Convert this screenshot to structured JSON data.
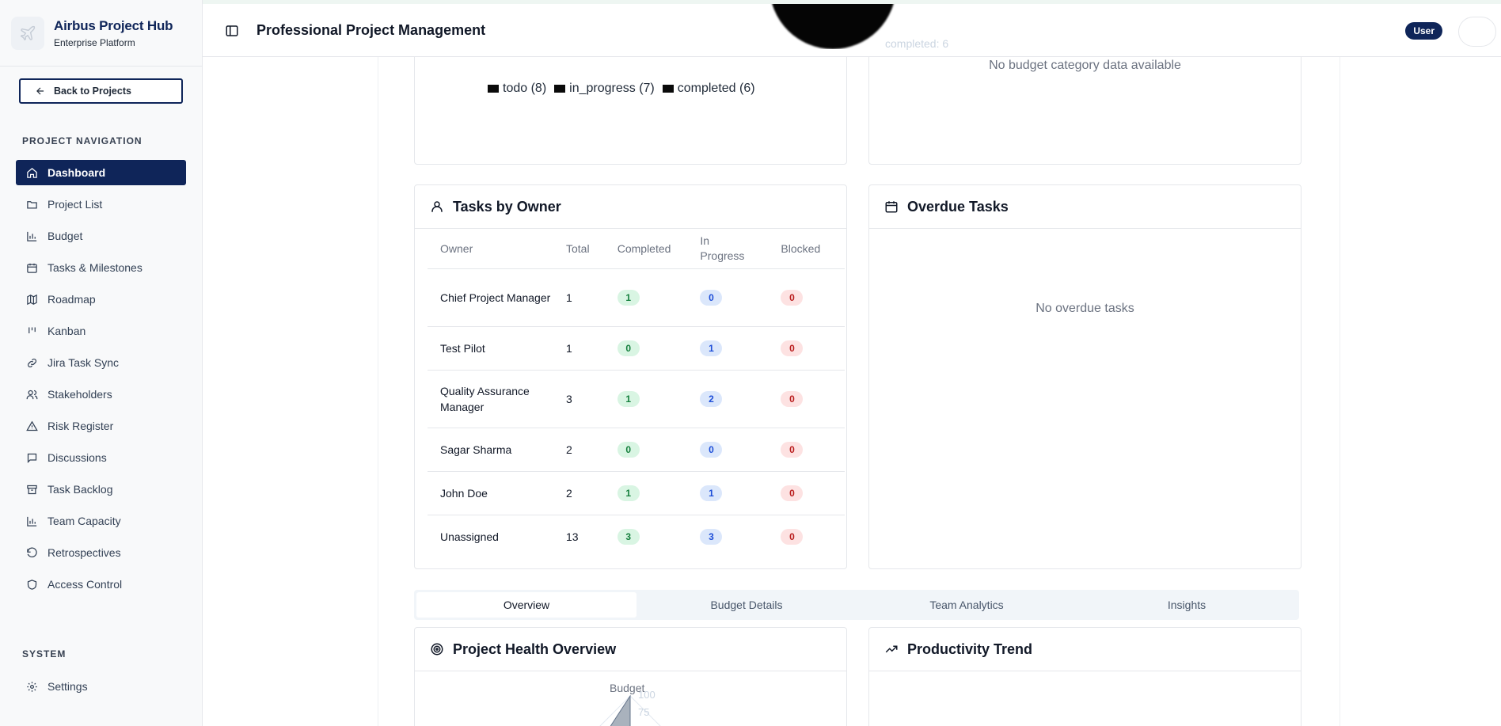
{
  "brand": {
    "title": "Airbus Project Hub",
    "subtitle": "Enterprise Platform"
  },
  "sidebar": {
    "back_label": "Back to Projects",
    "section_project": "PROJECT NAVIGATION",
    "items": [
      {
        "label": "Dashboard",
        "icon": "home-icon",
        "active": true
      },
      {
        "label": "Project List",
        "icon": "folder-icon"
      },
      {
        "label": "Budget",
        "icon": "bar-chart-icon"
      },
      {
        "label": "Tasks & Milestones",
        "icon": "calendar-icon"
      },
      {
        "label": "Roadmap",
        "icon": "map-icon"
      },
      {
        "label": "Kanban",
        "icon": "kanban-icon"
      },
      {
        "label": "Jira Task Sync",
        "icon": "link-icon"
      },
      {
        "label": "Stakeholders",
        "icon": "users-icon"
      },
      {
        "label": "Risk Register",
        "icon": "warning-icon"
      },
      {
        "label": "Discussions",
        "icon": "message-icon"
      },
      {
        "label": "Task Backlog",
        "icon": "archive-icon"
      },
      {
        "label": "Team Capacity",
        "icon": "bar-chart-icon"
      },
      {
        "label": "Retrospectives",
        "icon": "rotate-icon"
      },
      {
        "label": "Access Control",
        "icon": "shield-icon"
      }
    ],
    "section_system": "SYSTEM",
    "settings_label": "Settings"
  },
  "header": {
    "title": "Professional Project Management",
    "user_badge": "User",
    "ghost_label": "completed: 6"
  },
  "status_card": {
    "legend": [
      {
        "label": "todo (8)"
      },
      {
        "label": "in_progress (7)"
      },
      {
        "label": "completed (6)"
      }
    ]
  },
  "budget_card": {
    "empty": "No budget category data available"
  },
  "owners_card": {
    "title": "Tasks by Owner",
    "columns": [
      "Owner",
      "Total",
      "Completed",
      "In Progress",
      "Blocked"
    ],
    "rows": [
      {
        "owner": "Chief Project Manager",
        "total": "1",
        "completed": "1",
        "in_progress": "0",
        "blocked": "0"
      },
      {
        "owner": "Test Pilot",
        "total": "1",
        "completed": "0",
        "in_progress": "1",
        "blocked": "0"
      },
      {
        "owner": "Quality Assurance Manager",
        "total": "3",
        "completed": "1",
        "in_progress": "2",
        "blocked": "0"
      },
      {
        "owner": "Sagar Sharma",
        "total": "2",
        "completed": "0",
        "in_progress": "0",
        "blocked": "0"
      },
      {
        "owner": "John Doe",
        "total": "2",
        "completed": "1",
        "in_progress": "1",
        "blocked": "0"
      },
      {
        "owner": "Unassigned",
        "total": "13",
        "completed": "3",
        "in_progress": "3",
        "blocked": "0"
      }
    ]
  },
  "overdue_card": {
    "title": "Overdue Tasks",
    "empty": "No overdue tasks"
  },
  "tabs": [
    {
      "label": "Overview",
      "active": true
    },
    {
      "label": "Budget Details"
    },
    {
      "label": "Team Analytics"
    },
    {
      "label": "Insights"
    }
  ],
  "health_card": {
    "title": "Project Health Overview",
    "axis_label": "Budget",
    "ticks": [
      "100",
      "75"
    ]
  },
  "productivity_card": {
    "title": "Productivity Trend"
  }
}
